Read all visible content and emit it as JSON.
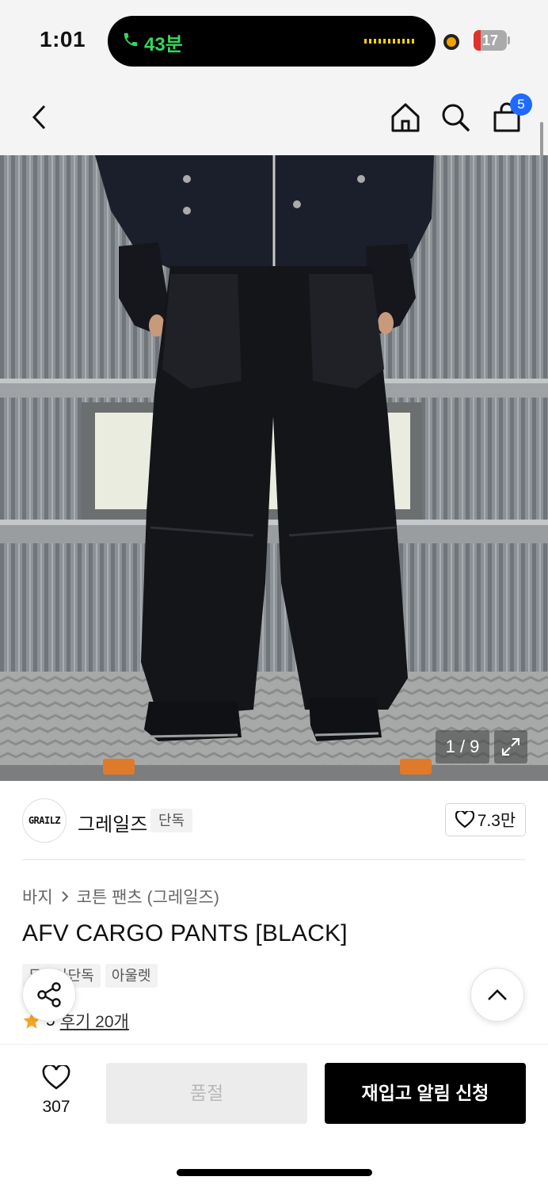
{
  "status_bar": {
    "time": "1:01",
    "call_duration": "43분",
    "battery": "17"
  },
  "nav": {
    "cart_count": "5"
  },
  "gallery": {
    "pager": "1 / 9"
  },
  "brand": {
    "logo_text": "GRAILZ",
    "name": "그레일즈",
    "exclusive_tag": "단독",
    "likes": "7.3만"
  },
  "product": {
    "breadcrumb": [
      "바지",
      "코튼 팬츠 (그레일즈)"
    ],
    "title": "AFV CARGO PANTS [BLACK]",
    "tags": [
      "무신사단독",
      "아울렛"
    ],
    "rating": "5",
    "reviews": "후기 20개"
  },
  "bottom_bar": {
    "wish_count": "307",
    "soldout_label": "품절",
    "restock_label": "재입고 알림 신청"
  },
  "colors": {
    "accent_badge": "#1f6bff",
    "call_green": "#35d65c",
    "star": "#f5a623"
  }
}
